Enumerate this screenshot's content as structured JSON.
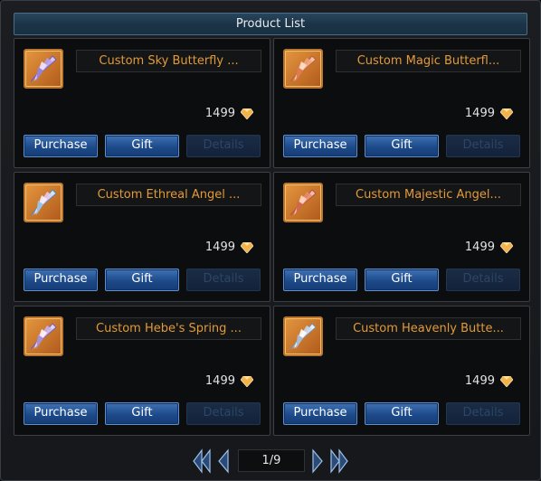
{
  "header": {
    "title": "Product List"
  },
  "products": [
    {
      "name": "Custom Sky Butterfly ...",
      "price": "1499",
      "purchase_label": "Purchase",
      "gift_label": "Gift",
      "details_label": "Details"
    },
    {
      "name": "Custom Magic Butterfl...",
      "price": "1499",
      "purchase_label": "Purchase",
      "gift_label": "Gift",
      "details_label": "Details"
    },
    {
      "name": "Custom Ethreal Angel ...",
      "price": "1499",
      "purchase_label": "Purchase",
      "gift_label": "Gift",
      "details_label": "Details"
    },
    {
      "name": "Custom Majestic Angel...",
      "price": "1499",
      "purchase_label": "Purchase",
      "gift_label": "Gift",
      "details_label": "Details"
    },
    {
      "name": "Custom Hebe's Spring ...",
      "price": "1499",
      "purchase_label": "Purchase",
      "gift_label": "Gift",
      "details_label": "Details"
    },
    {
      "name": "Custom Heavenly Butte...",
      "price": "1499",
      "purchase_label": "Purchase",
      "gift_label": "Gift",
      "details_label": "Details"
    }
  ],
  "pagination": {
    "page_text": "1/9"
  },
  "colors": {
    "accent_orange": "#e39a36",
    "button_blue": "#1d4a8a",
    "title_bar": "#1d3447"
  },
  "icons": {
    "currency": "diamond-gem-icon",
    "item": "wing-icon"
  }
}
